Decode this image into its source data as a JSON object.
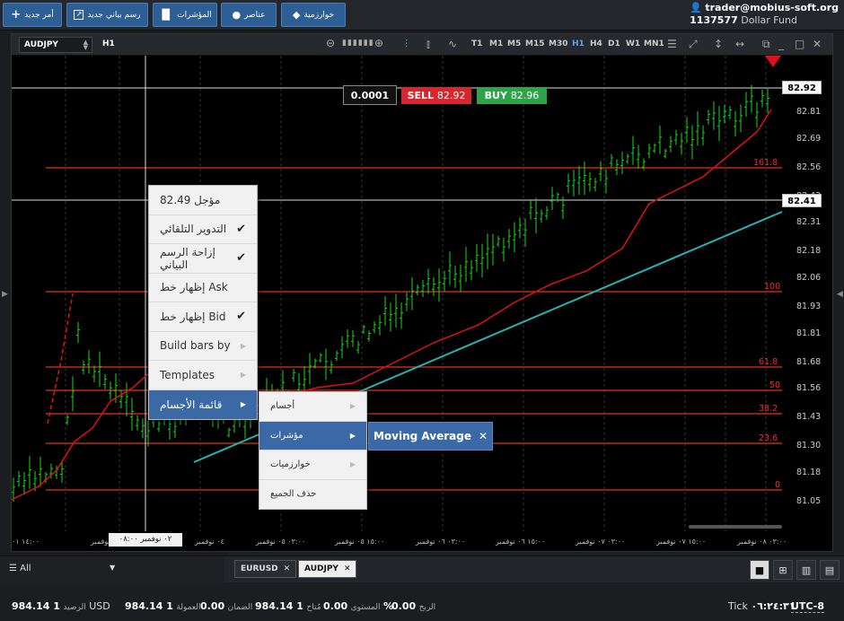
{
  "toolbar": {
    "new_order": "أمر جديد",
    "new_chart": "رسم بياني جديد",
    "indicators": "المؤشرات",
    "elements": "عناصر",
    "algorithms": "خوارزمية"
  },
  "account": {
    "email": "trader@mobius-soft.org",
    "id": "1137577",
    "fund": "Dollar Fund"
  },
  "chart_toolbar": {
    "symbol": "AUDJPY",
    "timeframe": "H1",
    "timeframes": [
      "T1",
      "M1",
      "M5",
      "M15",
      "M30",
      "H1",
      "H4",
      "D1",
      "W1",
      "MN1"
    ],
    "active_timeframe": "H1"
  },
  "trade": {
    "quantity": "0.0001",
    "sell_label": "SELL",
    "sell_price": "82.92",
    "buy_label": "BUY",
    "buy_price": "82.96"
  },
  "price_axis": [
    "82.81",
    "82.69",
    "82.56",
    "82.43",
    "82.31",
    "82.18",
    "82.06",
    "81.93",
    "81.81",
    "81.68",
    "81.56",
    "81.43",
    "81.30",
    "81.18",
    "81.05"
  ],
  "current_price_box": "82.92",
  "crosshair_price_box": "82.41",
  "fib_levels": [
    "161.8",
    "100",
    "61.8",
    "50",
    "38.2",
    "23.6",
    "0"
  ],
  "x_axis": [
    "١٤:٠٠ ٠١",
    "٠٢ نوفمبر",
    "٠٨:٠٠ ٠٢ نوفمبر",
    "٠٢ نوفمبر",
    "٠٤ نوفمبر",
    "٠٣:٠٠ ٠٥ نوفمبر",
    "١٥:٠٠ ٠٥ نوفمبر",
    "٠٣:٠٠ ٠٦ نوفمبر",
    "١٥:٠٠ ٠٦ نوفمبر",
    "٠٣:٠٠ ٠٧ نوفمبر",
    "١٥:٠٠ ٠٧ نوفمبر",
    "٠٣:٠٠ ٠٨ نوفمبر"
  ],
  "crosshair_time": "٠٢ نوفمبر ٠٨:٠٠",
  "context_menu": [
    {
      "label": "82.49 مؤجل",
      "check": false,
      "arrow": false
    },
    {
      "label": "التدوير التلقائي",
      "check": true,
      "arrow": false
    },
    {
      "label": "إزاحة الرسم البياني",
      "check": true,
      "arrow": false
    },
    {
      "label": "إظهار خط Ask",
      "check": false,
      "arrow": false
    },
    {
      "label": "إظهار خط Bid",
      "check": true,
      "arrow": false
    },
    {
      "label": "Build bars by",
      "check": false,
      "arrow": true
    },
    {
      "label": "Templates",
      "check": false,
      "arrow": true
    },
    {
      "label": "قائمة الأجسام",
      "check": false,
      "arrow": true,
      "selected": true
    }
  ],
  "submenu": [
    {
      "label": "أجسام",
      "selected": false
    },
    {
      "label": "مؤشرات",
      "selected": true
    },
    {
      "label": "خوارزميات",
      "selected": false
    },
    {
      "label": "حذف الجميع",
      "selected": false
    }
  ],
  "moving_average": {
    "label": "Moving Average",
    "close": "✕"
  },
  "tabs": {
    "filter": "All",
    "symbols": [
      {
        "label": "EURUSD",
        "active": false
      },
      {
        "label": "AUDJPY",
        "active": true
      }
    ]
  },
  "status": {
    "balance_value": "984.14 1",
    "balance_label": "الرصيد",
    "currency": "USD",
    "commission_value": "984.14 1",
    "commission_label": "العمولة",
    "margin_value": "0.00",
    "margin_label": "الضمان",
    "available_value": "984.14 1",
    "available_label": "مُتاح",
    "level_value": "0.00",
    "level_label": "المستوى",
    "percent": "%",
    "profit_value": "0.00",
    "profit_label": "الربح",
    "tick_label": "Tick",
    "tick_time": "٠٦:٢٤:٣١",
    "timezone": "UTC-8"
  },
  "colors": {
    "accent": "#2d5f95",
    "bullish": "#1fd31f",
    "ma_line": "#e0101a",
    "trend_line": "#25b3b3",
    "fib_line": "#e2341a",
    "sell": "#d6262e",
    "buy": "#2da44a"
  }
}
